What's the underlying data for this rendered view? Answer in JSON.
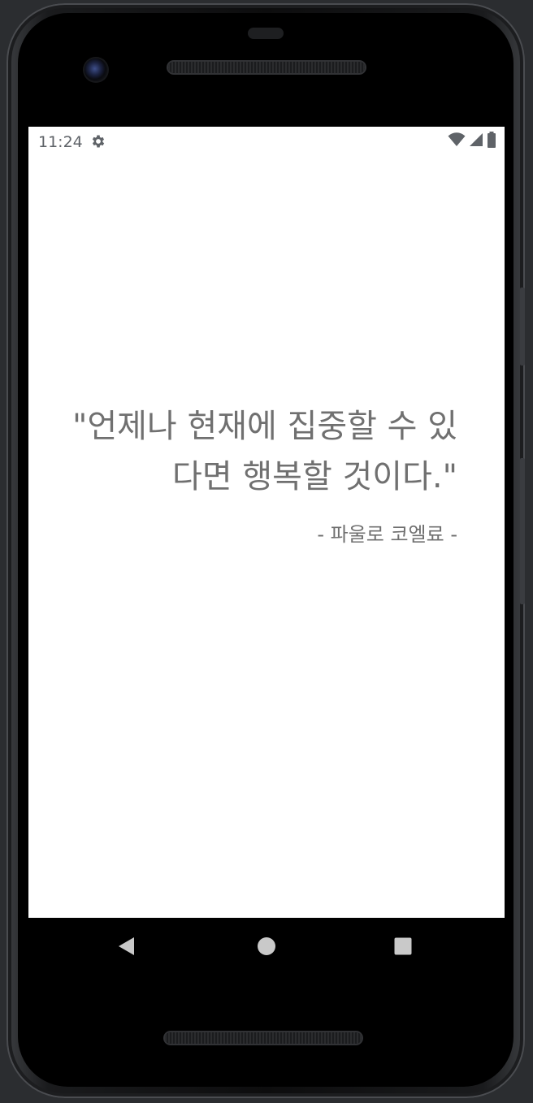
{
  "status_bar": {
    "time": "11:24",
    "left_icons": [
      "settings-gear-icon"
    ],
    "right_icons": [
      "wifi-icon",
      "cellular-signal-icon",
      "battery-icon"
    ]
  },
  "content": {
    "quote": "\"언제나 현재에 집중할 수 있다면 행복할 것이다.\"",
    "author": "- 파울로 코엘료 -"
  },
  "navigation_bar": {
    "buttons": [
      "back-icon",
      "home-icon",
      "recents-icon"
    ]
  },
  "colors": {
    "text": "#707070",
    "status_text": "#5f6368",
    "screen_background": "#ffffff",
    "device_bezel": "#000000"
  }
}
